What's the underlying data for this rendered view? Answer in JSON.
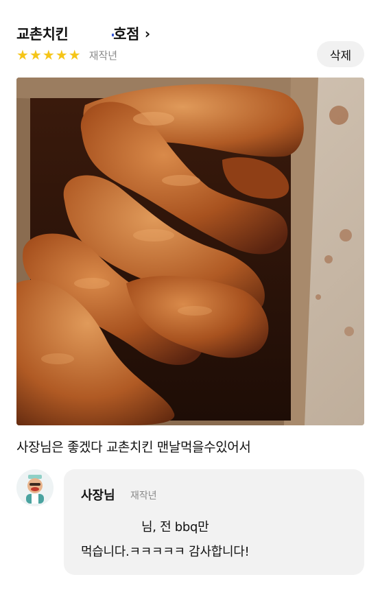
{
  "review": {
    "store_name_prefix": "교촌치킨",
    "store_name_suffix": "호점",
    "chevron": "›",
    "stars": [
      "★",
      "★",
      "★",
      "★",
      "★"
    ],
    "rating": 5,
    "time": "재작년",
    "delete_label": "삭제",
    "photo_icon": "fried-chicken-photo",
    "text": "사장님은 좋겠다 교촌치킨 맨날먹을수있어서"
  },
  "reply": {
    "author": "사장님",
    "time": "재작년",
    "line1": "님, 전 bbq만",
    "line2": "먹습니다.ㅋㅋㅋㅋㅋ 감사합니다!"
  },
  "colors": {
    "star": "#f5c518",
    "meta": "#8a8a8a",
    "bubble": "#f2f2f2",
    "delete_bg": "#f1f1f1"
  }
}
